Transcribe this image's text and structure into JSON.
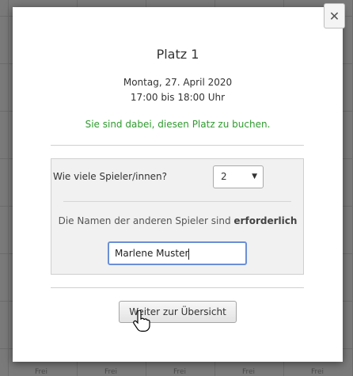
{
  "background": {
    "cell_label": "Frei"
  },
  "modal": {
    "title": "Platz 1",
    "date": "Montag, 27. April 2020",
    "time": "17:00 bis 18:00 Uhr",
    "notice": "Sie sind dabei, diesen Platz zu buchen.",
    "players_label": "Wie viele Spieler/innen?",
    "players_value": "2",
    "names_label_prefix": "Die Namen der anderen Spieler sind",
    "names_label_bold": "erforderlich",
    "name_input_value": "Marlene Muster",
    "continue_label": "Weiter zur Übersicht",
    "close_symbol": "✕"
  },
  "colors": {
    "notice": "#2e9a2e",
    "input_focus": "#6b8fd6"
  }
}
